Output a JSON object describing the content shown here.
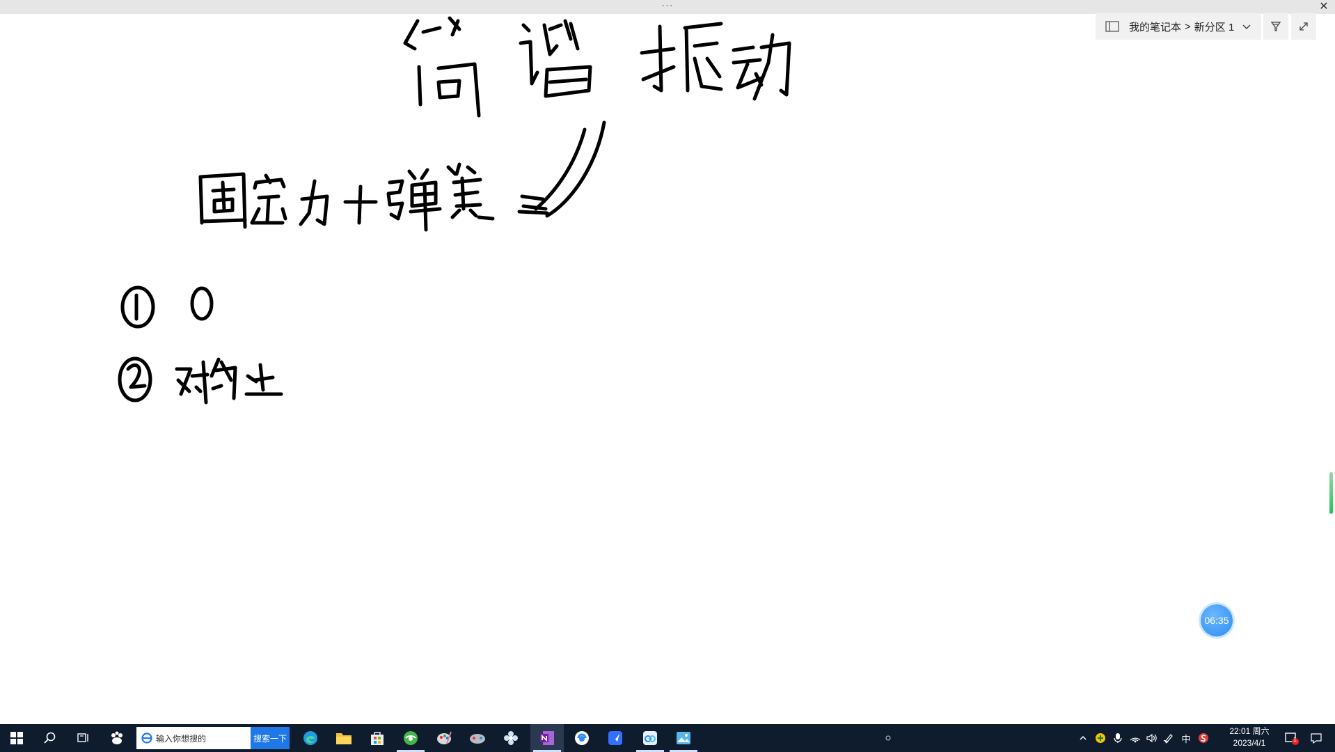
{
  "window": {
    "title_dots": "···",
    "close_glyph": "✕"
  },
  "breadcrumb": {
    "notebook": "我的笔记本",
    "separator": ">",
    "section": "新分区 1"
  },
  "canvas": {
    "handwriting_title": "简谐振动",
    "handwriting_line1": "固定力+弹簧",
    "handwriting_item1": "① O",
    "handwriting_item2": "② 对称点",
    "timer_text": "06:35"
  },
  "taskbar": {
    "search_placeholder": "输入你想搜的",
    "search_button": "搜索一下",
    "ime": "中",
    "clock_time": "22:01 周六",
    "clock_date": "2023/4/1",
    "notification_badge": "1",
    "apps": [
      "start",
      "search",
      "task-view",
      "baidu",
      "ie",
      "edge",
      "file-explorer",
      "store",
      "360-browser",
      "paint",
      "game",
      "flower",
      "onenote",
      "qq",
      "feishu",
      "baidu-netdisk",
      "gallery"
    ]
  },
  "colors": {
    "taskbar_bg": "#0f1c2e",
    "accent": "#1e78e8",
    "timer": "#2e8cf0",
    "ink": "#000000"
  }
}
